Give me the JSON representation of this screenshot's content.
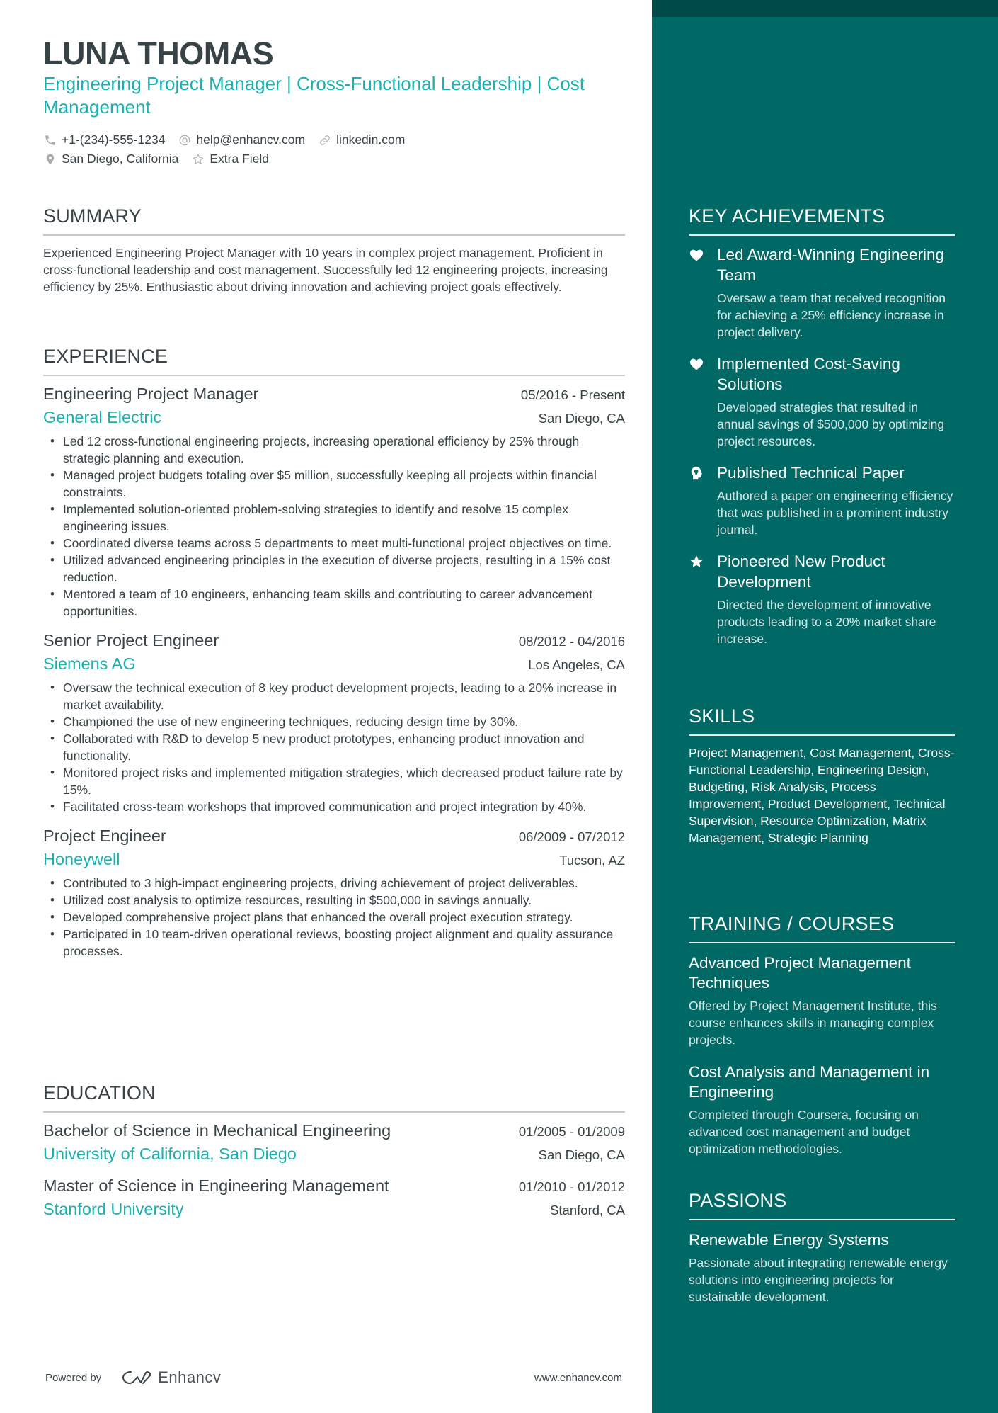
{
  "header": {
    "name": "LUNA THOMAS",
    "headline": "Engineering Project Manager | Cross-Functional Leadership | Cost Management",
    "contacts": [
      {
        "icon": "phone-icon",
        "text": "+1-(234)-555-1234"
      },
      {
        "icon": "at-icon",
        "text": "help@enhancv.com"
      },
      {
        "icon": "link-icon",
        "text": "linkedin.com"
      },
      {
        "icon": "location-pin-icon",
        "text": "San Diego, California"
      },
      {
        "icon": "star-outline-icon",
        "text": "Extra Field"
      }
    ]
  },
  "summary": {
    "title": "SUMMARY",
    "text": "Experienced Engineering Project Manager with 10 years in complex project management. Proficient in cross-functional leadership and cost management. Successfully led 12 engineering projects, increasing efficiency by 25%. Enthusiastic about driving innovation and achieving project goals effectively."
  },
  "experience": {
    "title": "EXPERIENCE",
    "items": [
      {
        "role": "Engineering Project Manager",
        "dates": "05/2016 - Present",
        "company": "General Electric",
        "location": "San Diego, CA",
        "bullets": [
          "Led 12 cross-functional engineering projects, increasing operational efficiency by 25% through strategic planning and execution.",
          "Managed project budgets totaling over $5 million, successfully keeping all projects within financial constraints.",
          "Implemented solution-oriented problem-solving strategies to identify and resolve 15 complex engineering issues.",
          "Coordinated diverse teams across 5 departments to meet multi-functional project objectives on time.",
          "Utilized advanced engineering principles in the execution of diverse projects, resulting in a 15% cost reduction.",
          "Mentored a team of 10 engineers, enhancing team skills and contributing to career advancement opportunities."
        ]
      },
      {
        "role": "Senior Project Engineer",
        "dates": "08/2012 - 04/2016",
        "company": "Siemens AG",
        "location": "Los Angeles, CA",
        "bullets": [
          "Oversaw the technical execution of 8 key product development projects, leading to a 20% increase in market availability.",
          "Championed the use of new engineering techniques, reducing design time by 30%.",
          "Collaborated with R&D to develop 5 new product prototypes, enhancing product innovation and functionality.",
          "Monitored project risks and implemented mitigation strategies, which decreased product failure rate by 15%.",
          "Facilitated cross-team workshops that improved communication and project integration by 40%."
        ]
      },
      {
        "role": "Project Engineer",
        "dates": "06/2009 - 07/2012",
        "company": "Honeywell",
        "location": "Tucson, AZ",
        "bullets": [
          "Contributed to 3 high-impact engineering projects, driving achievement of project deliverables.",
          "Utilized cost analysis to optimize resources, resulting in $500,000 in savings annually.",
          "Developed comprehensive project plans that enhanced the overall project execution strategy.",
          "Participated in 10 team-driven operational reviews, boosting project alignment and quality assurance processes."
        ]
      }
    ]
  },
  "education": {
    "title": "EDUCATION",
    "items": [
      {
        "degree": "Bachelor of Science in Mechanical Engineering",
        "dates": "01/2005 - 01/2009",
        "school": "University of California, San Diego",
        "location": "San Diego, CA"
      },
      {
        "degree": "Master of Science in Engineering Management",
        "dates": "01/2010 - 01/2012",
        "school": "Stanford University",
        "location": "Stanford, CA"
      }
    ]
  },
  "achievements": {
    "title": "KEY ACHIEVEMENTS",
    "items": [
      {
        "icon": "heart-icon",
        "title": "Led Award-Winning Engineering Team",
        "desc": "Oversaw a team that received recognition for achieving a 25% efficiency increase in project delivery."
      },
      {
        "icon": "heart-icon",
        "title": "Implemented Cost-Saving Solutions",
        "desc": "Developed strategies that resulted in annual savings of $500,000 by optimizing project resources."
      },
      {
        "icon": "brain-head-icon",
        "title": "Published Technical Paper",
        "desc": "Authored a paper on engineering efficiency that was published in a prominent industry journal."
      },
      {
        "icon": "star-icon",
        "title": "Pioneered New Product Development",
        "desc": "Directed the development of innovative products leading to a 20% market share increase."
      }
    ]
  },
  "skills": {
    "title": "SKILLS",
    "text": "Project Management, Cost Management, Cross-Functional Leadership, Engineering Design, Budgeting, Risk Analysis, Process Improvement, Product Development, Technical Supervision, Resource Optimization, Matrix Management, Strategic Planning"
  },
  "training": {
    "title": "TRAINING / COURSES",
    "items": [
      {
        "title": "Advanced Project Management Techniques",
        "desc": "Offered by Project Management Institute, this course enhances skills in managing complex projects."
      },
      {
        "title": "Cost Analysis and Management in Engineering",
        "desc": "Completed through Coursera, focusing on advanced cost management and budget optimization methodologies."
      }
    ]
  },
  "passions": {
    "title": "PASSIONS",
    "items": [
      {
        "title": "Renewable Energy Systems",
        "desc": "Passionate about integrating renewable energy solutions into engineering projects for sustainable development."
      }
    ]
  },
  "footer": {
    "powered_by": "Powered by",
    "brand": "Enhancv",
    "website": "www.enhancv.com"
  },
  "colors": {
    "accent": "#1ab1b1",
    "sidebar": "#006865",
    "sidebar_strip": "#004a4a",
    "text": "#384347"
  }
}
